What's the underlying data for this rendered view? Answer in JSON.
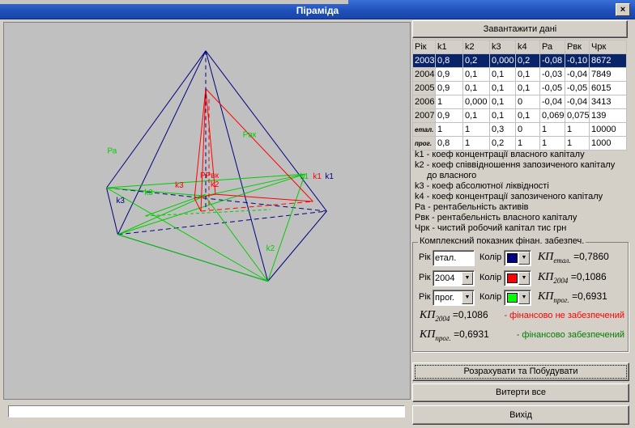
{
  "window": {
    "title": "Піраміда",
    "close_label": "×"
  },
  "buttons": {
    "load": "Завантажити дані",
    "calculate": "Розрахувати та Побудувати",
    "clear": "Витерти все",
    "exit": "Вихід"
  },
  "table": {
    "headers": [
      "Рік",
      "k1",
      "k2",
      "k3",
      "k4",
      "Ра",
      "Рвк",
      "Чрк"
    ],
    "rows": [
      [
        "2003",
        "0,8",
        "0,2",
        "0,000",
        "0,2",
        "-0,08",
        "-0,10",
        "8672"
      ],
      [
        "2004",
        "0,9",
        "0,1",
        "0,1",
        "0,1",
        "-0,03",
        "-0,04",
        "7849"
      ],
      [
        "2005",
        "0,9",
        "0,1",
        "0,1",
        "0,1",
        "-0,05",
        "-0,05",
        "6015"
      ],
      [
        "2006",
        "1",
        "0,000",
        "0,1",
        "0",
        "-0,04",
        "-0,04",
        "3413"
      ],
      [
        "2007",
        "0,9",
        "0,1",
        "0,1",
        "0,1",
        "0,069",
        "0,075",
        "139"
      ],
      [
        "етал.",
        "1",
        "1",
        "0,3",
        "0",
        "1",
        "1",
        "10000"
      ],
      [
        "прог.",
        "0,8",
        "1",
        "0,2",
        "1",
        "1",
        "1",
        "1000"
      ]
    ]
  },
  "legend": [
    "k1 - коеф концентрації власного капіталу",
    "k2 - коеф співвідношення запозиченого капіталу",
    "до власного",
    "k3 - коеф абсолютної ліквідності",
    "k4 - коеф концентрації запозиченого капіталу",
    "Ра - рентабельність активів",
    "Рвк - рентабельність власного капіталу",
    "Чрк - чистий робочий капітал тис грн"
  ],
  "group": {
    "title": "Комплексний показник фінан. забезпеч.",
    "year_label": "Рік",
    "color_label": "Колір",
    "rows": [
      {
        "year": "етал.",
        "color": "#000080",
        "kp": "КП",
        "sub": "етал.",
        "value": "=0,7860"
      },
      {
        "year": "2004",
        "color": "#ff0000",
        "kp": "КП",
        "sub": "2004",
        "value": "=0,1086"
      },
      {
        "year": "прог.",
        "color": "#00ff00",
        "kp": "КП",
        "sub": "прог.",
        "value": "=0,6931"
      }
    ],
    "status": [
      {
        "kp": "КП",
        "sub": "2004",
        "value": "=0,1086",
        "text": "- фінансово не забезпечений",
        "color": "#ff0000"
      },
      {
        "kp": "КП",
        "sub": "прог.",
        "value": "=0,6931",
        "text": "- фінансово забезпечений",
        "color": "#008000"
      }
    ]
  },
  "plot_labels": {
    "ra": "Ра",
    "rvk": "Рвк",
    "rvk_inner": "РРвк",
    "k1": "k1",
    "k2": "k2",
    "k3": "k3"
  },
  "colors": {
    "navy": "#000080",
    "red": "#ff0000",
    "green": "#00ff00",
    "selection": "#0a246a"
  }
}
